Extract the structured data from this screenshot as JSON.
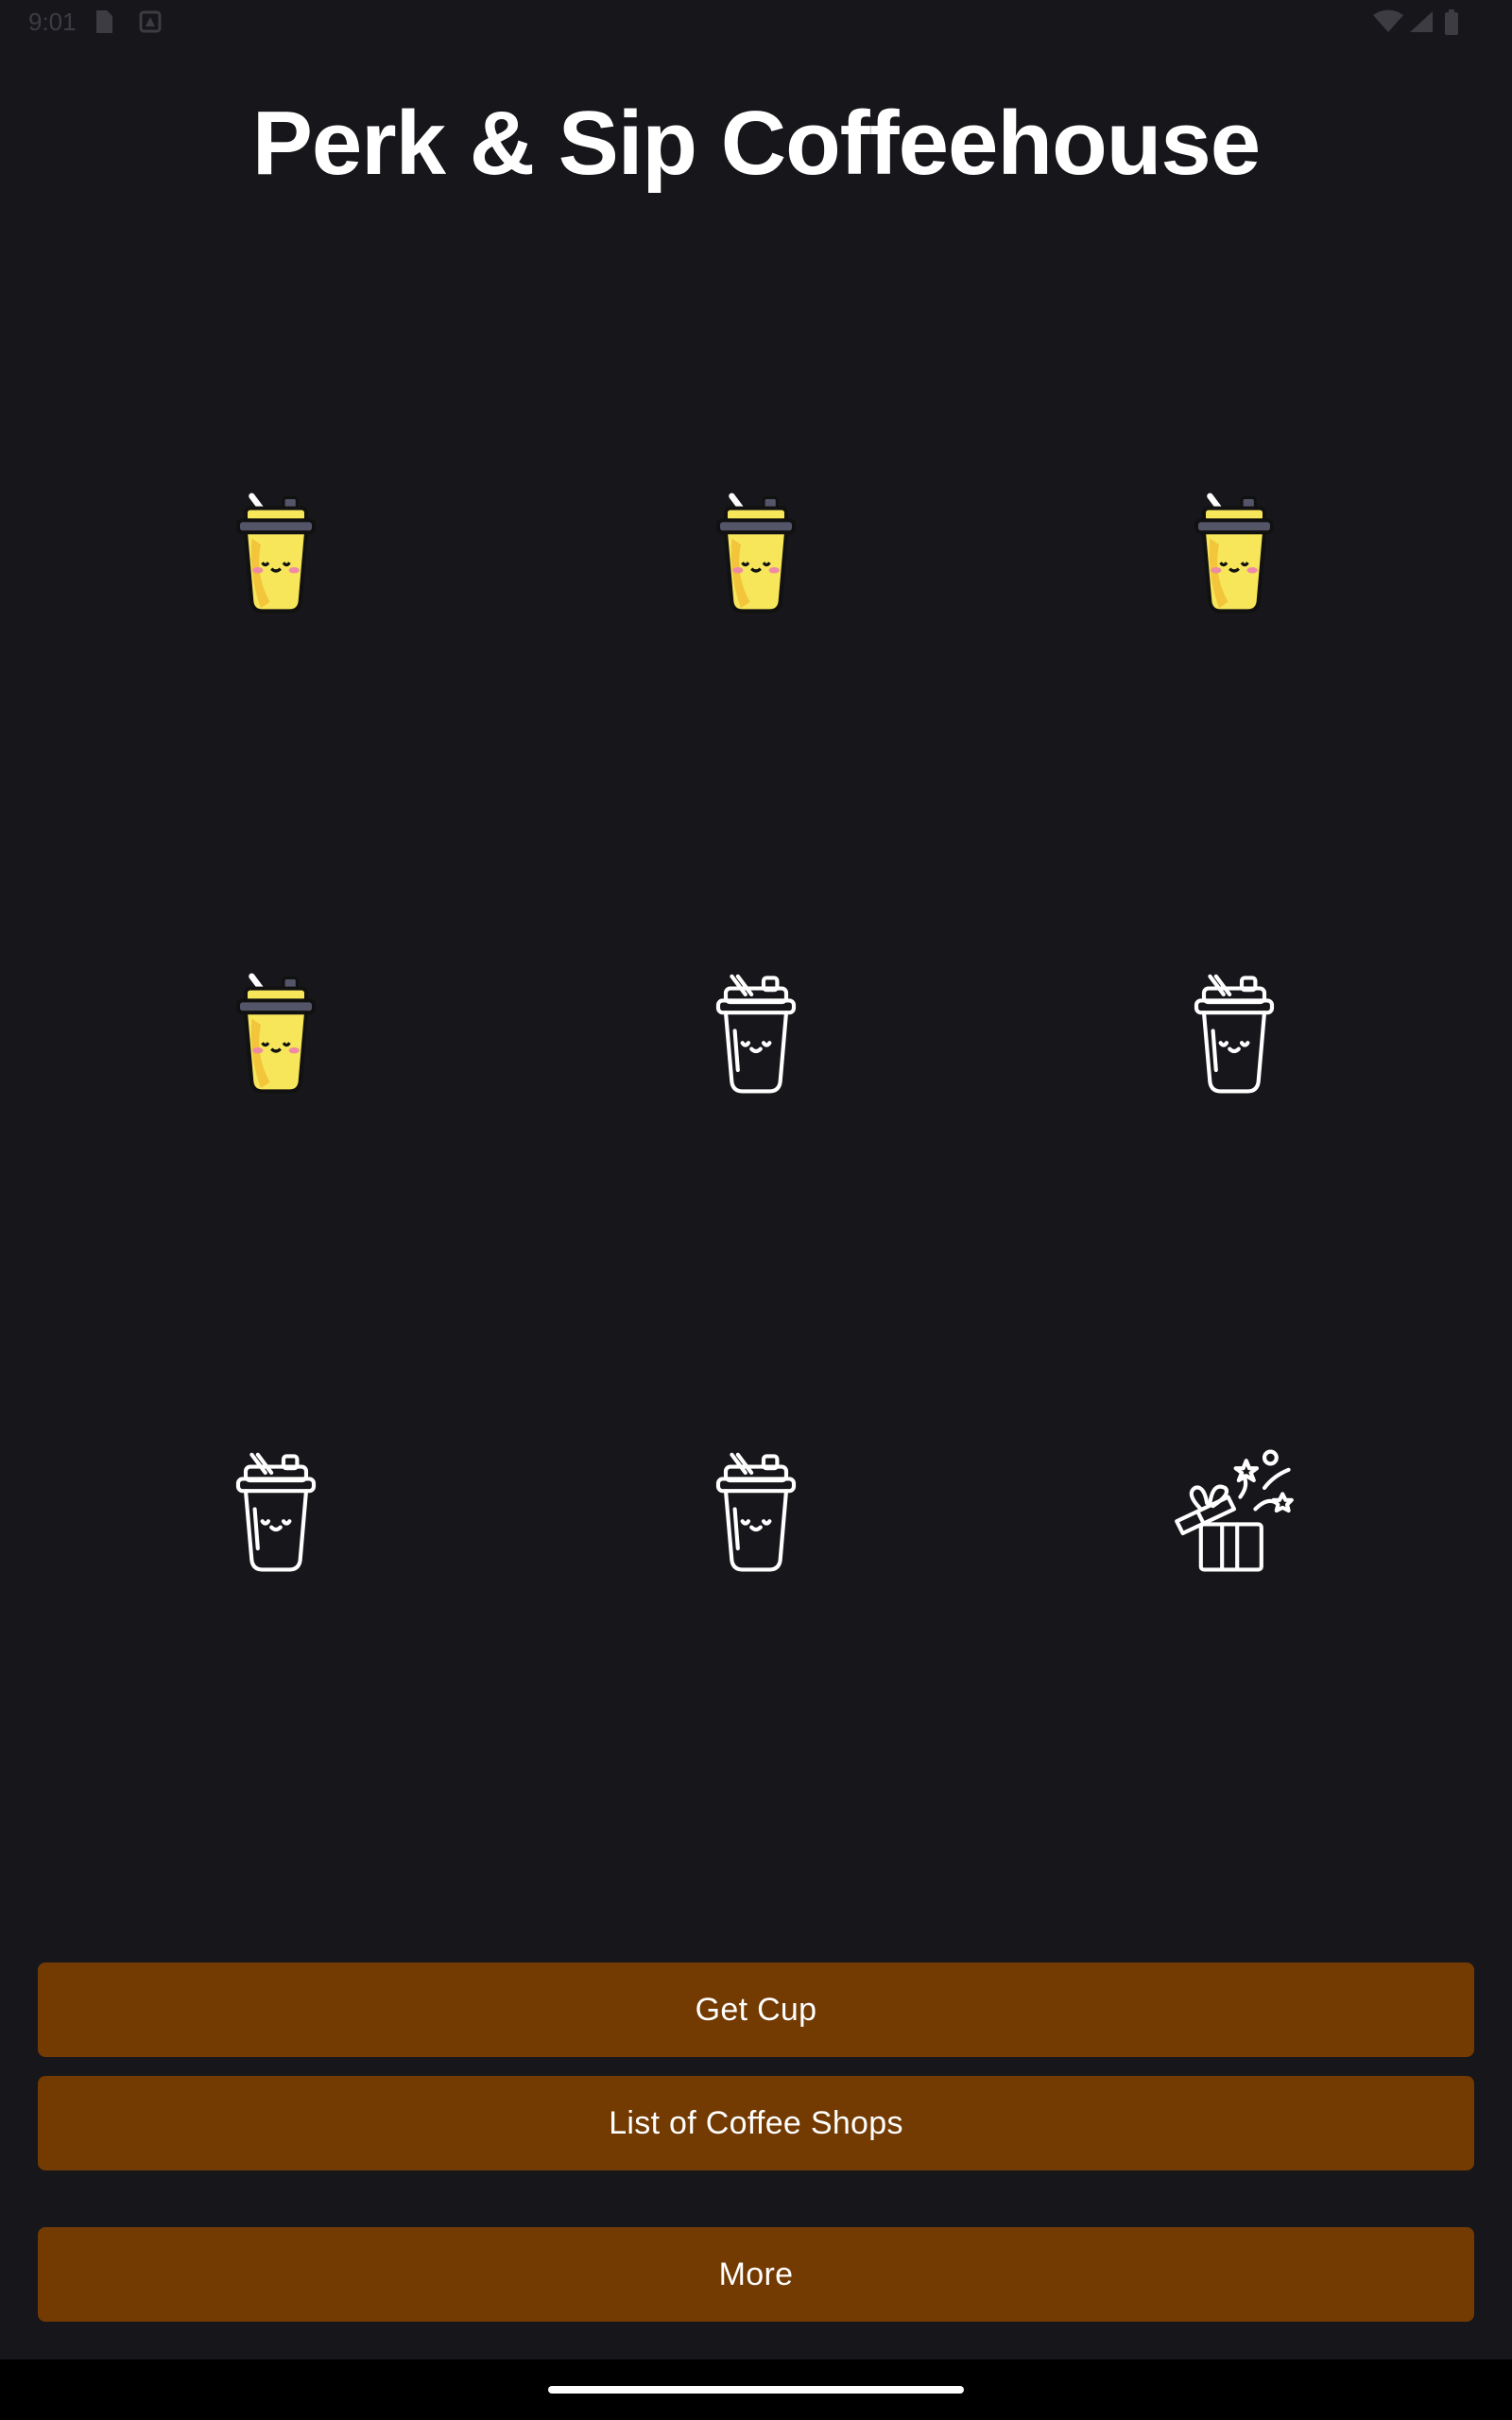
{
  "status_bar": {
    "time": "9:01",
    "icons": [
      "sim-card-icon",
      "app-notification-icon",
      "wifi-icon",
      "signal-icon",
      "battery-icon"
    ]
  },
  "header": {
    "title": "Perk & Sip Coffeehouse"
  },
  "stamp_card": {
    "filled_count": 4,
    "total_cups": 8,
    "reward_icon": "gift-icon",
    "cells": [
      {
        "icon": "cup-filled-icon",
        "filled": true
      },
      {
        "icon": "cup-filled-icon",
        "filled": true
      },
      {
        "icon": "cup-filled-icon",
        "filled": true
      },
      {
        "icon": "cup-filled-icon",
        "filled": true
      },
      {
        "icon": "cup-outline-icon",
        "filled": false
      },
      {
        "icon": "cup-outline-icon",
        "filled": false
      },
      {
        "icon": "cup-outline-icon",
        "filled": false
      },
      {
        "icon": "cup-outline-icon",
        "filled": false
      },
      {
        "icon": "gift-icon",
        "filled": false
      }
    ]
  },
  "actions": {
    "get_cup_label": "Get Cup",
    "coffee_shops_label": "List of Coffee Shops",
    "more_label": "More"
  },
  "colors": {
    "background": "#16161b",
    "button": "#733a02",
    "cup_yellow": "#f7e65a",
    "cup_lid": "#55556a"
  }
}
